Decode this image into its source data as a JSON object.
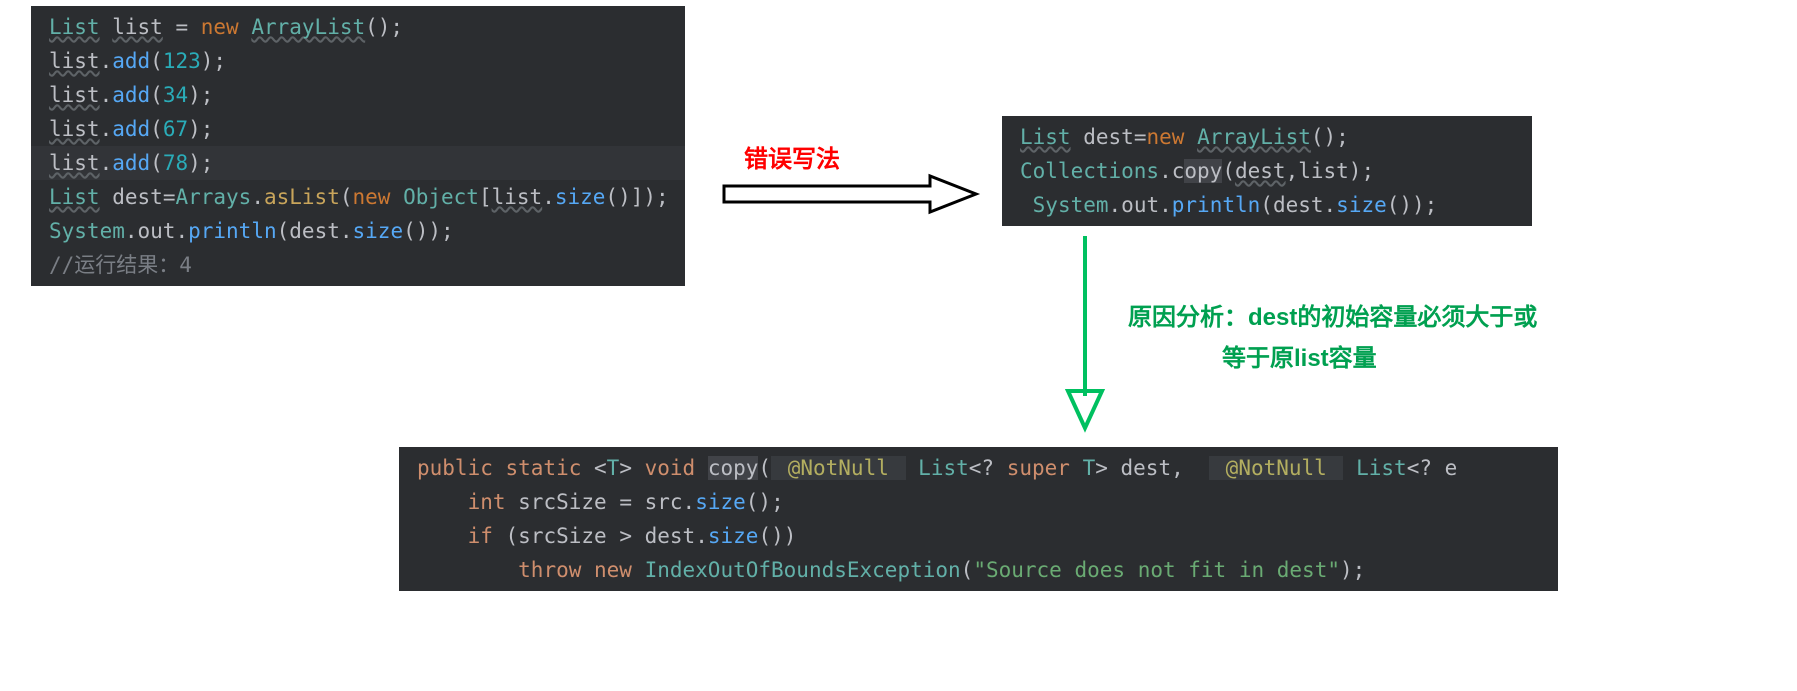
{
  "block1": {
    "lines": [
      [
        [
          "type",
          "List"
        ],
        [
          "punc",
          " "
        ],
        [
          "ident-u",
          "list"
        ],
        [
          "punc",
          " = "
        ],
        [
          "kw",
          "new"
        ],
        [
          "punc",
          " "
        ],
        [
          "type",
          "ArrayList"
        ],
        [
          "punc",
          "();"
        ]
      ],
      [
        [
          "ident-u",
          "list"
        ],
        [
          "punc",
          "."
        ],
        [
          "method",
          "add"
        ],
        [
          "punc",
          "("
        ],
        [
          "num",
          "123"
        ],
        [
          "punc",
          ");"
        ]
      ],
      [
        [
          "ident-u",
          "list"
        ],
        [
          "punc",
          "."
        ],
        [
          "method",
          "add"
        ],
        [
          "punc",
          "("
        ],
        [
          "num",
          "34"
        ],
        [
          "punc",
          ");"
        ]
      ],
      [
        [
          "ident-u",
          "list"
        ],
        [
          "punc",
          "."
        ],
        [
          "method",
          "add"
        ],
        [
          "punc",
          "("
        ],
        [
          "num",
          "67"
        ],
        [
          "punc",
          ");"
        ]
      ],
      [
        [
          "ident-u",
          "list"
        ],
        [
          "punc",
          "."
        ],
        [
          "method",
          "add"
        ],
        [
          "punc",
          "("
        ],
        [
          "num",
          "78"
        ],
        [
          "punc",
          ");"
        ]
      ],
      [
        [
          "type",
          "List"
        ],
        [
          "punc",
          " "
        ],
        [
          "ident",
          "dest"
        ],
        [
          "punc",
          "="
        ],
        [
          "type-plain",
          "Arrays"
        ],
        [
          "punc",
          "."
        ],
        [
          "method-y",
          "asList"
        ],
        [
          "punc",
          "("
        ],
        [
          "kw",
          "new"
        ],
        [
          "punc",
          " "
        ],
        [
          "type-plain",
          "Object"
        ],
        [
          "punc",
          "["
        ],
        [
          "ident-u",
          "list"
        ],
        [
          "punc",
          "."
        ],
        [
          "method",
          "size"
        ],
        [
          "punc",
          "()]);"
        ]
      ],
      [
        [
          "type-plain",
          "System"
        ],
        [
          "punc",
          "."
        ],
        [
          "ident",
          "out"
        ],
        [
          "punc",
          "."
        ],
        [
          "method",
          "println"
        ],
        [
          "punc",
          "("
        ],
        [
          "ident",
          "dest"
        ],
        [
          "punc",
          "."
        ],
        [
          "method",
          "size"
        ],
        [
          "punc",
          "());"
        ]
      ],
      [
        [
          "comment",
          "//运行结果：4"
        ]
      ]
    ],
    "highlight_line": 4
  },
  "block2": {
    "lines": [
      [
        [
          "type",
          "List"
        ],
        [
          "punc",
          " "
        ],
        [
          "ident",
          "dest"
        ],
        [
          "punc",
          "="
        ],
        [
          "kw",
          "new"
        ],
        [
          "punc",
          " "
        ],
        [
          "type",
          "ArrayList"
        ],
        [
          "punc",
          "();"
        ]
      ],
      [
        [
          "type-plain",
          "Collections"
        ],
        [
          "punc",
          "."
        ],
        [
          "ident",
          "c"
        ],
        [
          "cursor",
          "opy"
        ],
        [
          "punc",
          "("
        ],
        [
          "ident-u",
          "dest"
        ],
        [
          "punc",
          ","
        ],
        [
          "ident",
          "list"
        ],
        [
          "punc",
          ");"
        ]
      ],
      [
        [
          "punc",
          " "
        ],
        [
          "type-plain",
          "System"
        ],
        [
          "punc",
          "."
        ],
        [
          "ident",
          "out"
        ],
        [
          "punc",
          "."
        ],
        [
          "method",
          "println"
        ],
        [
          "punc",
          "("
        ],
        [
          "ident",
          "dest"
        ],
        [
          "punc",
          "."
        ],
        [
          "method",
          "size"
        ],
        [
          "punc",
          "());"
        ]
      ]
    ]
  },
  "block3": {
    "lines": [
      [
        [
          "kw2",
          "public static "
        ],
        [
          "punc",
          "<"
        ],
        [
          "type-plain",
          "T"
        ],
        [
          "punc",
          "> "
        ],
        [
          "kw2",
          "void "
        ],
        [
          "cursor",
          "copy"
        ],
        [
          "punc",
          "("
        ],
        [
          "anno-bg",
          " @NotNull "
        ],
        [
          "punc",
          " "
        ],
        [
          "type-plain",
          "List"
        ],
        [
          "punc",
          "<? "
        ],
        [
          "kw2",
          "super"
        ],
        [
          "punc",
          " "
        ],
        [
          "type-plain",
          "T"
        ],
        [
          "punc",
          "> "
        ],
        [
          "param",
          "dest"
        ],
        [
          "punc",
          ",  "
        ],
        [
          "anno-bg",
          " @NotNull "
        ],
        [
          "punc",
          " "
        ],
        [
          "type-plain",
          "List"
        ],
        [
          "punc",
          "<? e"
        ]
      ],
      [
        [
          "punc",
          "    "
        ],
        [
          "kw2",
          "int "
        ],
        [
          "ident",
          "srcSize"
        ],
        [
          "punc",
          " = "
        ],
        [
          "ident",
          "src"
        ],
        [
          "punc",
          "."
        ],
        [
          "method",
          "size"
        ],
        [
          "punc",
          "();"
        ]
      ],
      [
        [
          "punc",
          "    "
        ],
        [
          "kw2",
          "if "
        ],
        [
          "punc",
          "("
        ],
        [
          "ident",
          "srcSize"
        ],
        [
          "punc",
          " > "
        ],
        [
          "ident",
          "dest"
        ],
        [
          "punc",
          "."
        ],
        [
          "method",
          "size"
        ],
        [
          "punc",
          "())"
        ]
      ],
      [
        [
          "punc",
          "        "
        ],
        [
          "kw2",
          "throw new "
        ],
        [
          "type-plain",
          "IndexOutOfBoundsException"
        ],
        [
          "punc",
          "("
        ],
        [
          "string",
          "\"Source does not fit in dest\""
        ],
        [
          "punc",
          ");"
        ]
      ]
    ]
  },
  "labels": {
    "error_label": "错误写法",
    "reason_line1": "原因分析：dest的初始容量必须大于或",
    "reason_line2": "等于原list容量"
  }
}
